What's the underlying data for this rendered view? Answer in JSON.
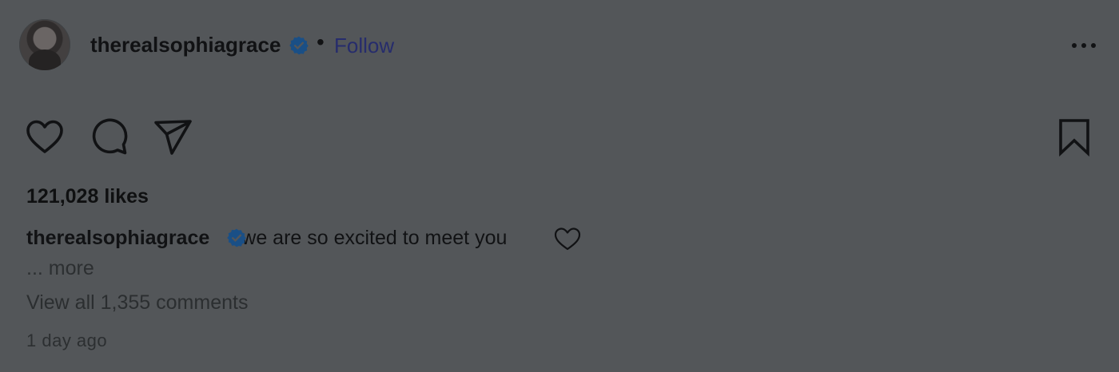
{
  "post": {
    "username": "therealsophiagrace",
    "separator": "•",
    "follow_label": "Follow",
    "likes": "121,028 likes",
    "caption_user": "therealsophiagrace",
    "caption_text": "we are so excited to meet you",
    "more_label": "... more",
    "view_comments": "View all 1,355 comments",
    "timestamp": "1 day ago"
  },
  "icons": {
    "verified": "verified-badge-icon",
    "more": "more-options-icon",
    "like": "heart-icon",
    "comment": "comment-icon",
    "share": "share-icon",
    "save": "bookmark-icon",
    "caption_emoji": "heart-emoji-icon"
  },
  "colors": {
    "background": "#535659",
    "verified": "#1a4f86",
    "follow": "#262c6c",
    "text": "#111214"
  }
}
